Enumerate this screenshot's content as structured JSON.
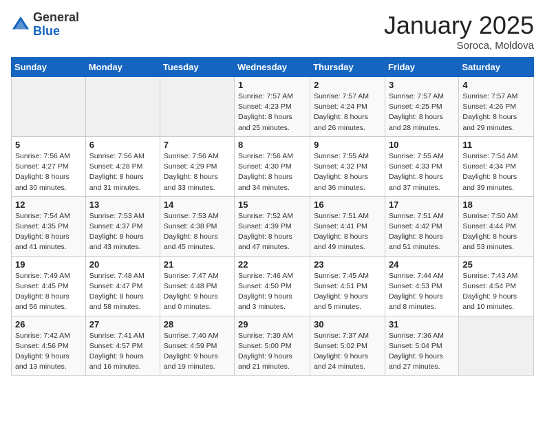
{
  "header": {
    "logo_general": "General",
    "logo_blue": "Blue",
    "month_title": "January 2025",
    "location": "Soroca, Moldova"
  },
  "weekdays": [
    "Sunday",
    "Monday",
    "Tuesday",
    "Wednesday",
    "Thursday",
    "Friday",
    "Saturday"
  ],
  "weeks": [
    [
      {
        "day": "",
        "info": ""
      },
      {
        "day": "",
        "info": ""
      },
      {
        "day": "",
        "info": ""
      },
      {
        "day": "1",
        "info": "Sunrise: 7:57 AM\nSunset: 4:23 PM\nDaylight: 8 hours\nand 25 minutes."
      },
      {
        "day": "2",
        "info": "Sunrise: 7:57 AM\nSunset: 4:24 PM\nDaylight: 8 hours\nand 26 minutes."
      },
      {
        "day": "3",
        "info": "Sunrise: 7:57 AM\nSunset: 4:25 PM\nDaylight: 8 hours\nand 28 minutes."
      },
      {
        "day": "4",
        "info": "Sunrise: 7:57 AM\nSunset: 4:26 PM\nDaylight: 8 hours\nand 29 minutes."
      }
    ],
    [
      {
        "day": "5",
        "info": "Sunrise: 7:56 AM\nSunset: 4:27 PM\nDaylight: 8 hours\nand 30 minutes."
      },
      {
        "day": "6",
        "info": "Sunrise: 7:56 AM\nSunset: 4:28 PM\nDaylight: 8 hours\nand 31 minutes."
      },
      {
        "day": "7",
        "info": "Sunrise: 7:56 AM\nSunset: 4:29 PM\nDaylight: 8 hours\nand 33 minutes."
      },
      {
        "day": "8",
        "info": "Sunrise: 7:56 AM\nSunset: 4:30 PM\nDaylight: 8 hours\nand 34 minutes."
      },
      {
        "day": "9",
        "info": "Sunrise: 7:55 AM\nSunset: 4:32 PM\nDaylight: 8 hours\nand 36 minutes."
      },
      {
        "day": "10",
        "info": "Sunrise: 7:55 AM\nSunset: 4:33 PM\nDaylight: 8 hours\nand 37 minutes."
      },
      {
        "day": "11",
        "info": "Sunrise: 7:54 AM\nSunset: 4:34 PM\nDaylight: 8 hours\nand 39 minutes."
      }
    ],
    [
      {
        "day": "12",
        "info": "Sunrise: 7:54 AM\nSunset: 4:35 PM\nDaylight: 8 hours\nand 41 minutes."
      },
      {
        "day": "13",
        "info": "Sunrise: 7:53 AM\nSunset: 4:37 PM\nDaylight: 8 hours\nand 43 minutes."
      },
      {
        "day": "14",
        "info": "Sunrise: 7:53 AM\nSunset: 4:38 PM\nDaylight: 8 hours\nand 45 minutes."
      },
      {
        "day": "15",
        "info": "Sunrise: 7:52 AM\nSunset: 4:39 PM\nDaylight: 8 hours\nand 47 minutes."
      },
      {
        "day": "16",
        "info": "Sunrise: 7:51 AM\nSunset: 4:41 PM\nDaylight: 8 hours\nand 49 minutes."
      },
      {
        "day": "17",
        "info": "Sunrise: 7:51 AM\nSunset: 4:42 PM\nDaylight: 8 hours\nand 51 minutes."
      },
      {
        "day": "18",
        "info": "Sunrise: 7:50 AM\nSunset: 4:44 PM\nDaylight: 8 hours\nand 53 minutes."
      }
    ],
    [
      {
        "day": "19",
        "info": "Sunrise: 7:49 AM\nSunset: 4:45 PM\nDaylight: 8 hours\nand 56 minutes."
      },
      {
        "day": "20",
        "info": "Sunrise: 7:48 AM\nSunset: 4:47 PM\nDaylight: 8 hours\nand 58 minutes."
      },
      {
        "day": "21",
        "info": "Sunrise: 7:47 AM\nSunset: 4:48 PM\nDaylight: 9 hours\nand 0 minutes."
      },
      {
        "day": "22",
        "info": "Sunrise: 7:46 AM\nSunset: 4:50 PM\nDaylight: 9 hours\nand 3 minutes."
      },
      {
        "day": "23",
        "info": "Sunrise: 7:45 AM\nSunset: 4:51 PM\nDaylight: 9 hours\nand 5 minutes."
      },
      {
        "day": "24",
        "info": "Sunrise: 7:44 AM\nSunset: 4:53 PM\nDaylight: 9 hours\nand 8 minutes."
      },
      {
        "day": "25",
        "info": "Sunrise: 7:43 AM\nSunset: 4:54 PM\nDaylight: 9 hours\nand 10 minutes."
      }
    ],
    [
      {
        "day": "26",
        "info": "Sunrise: 7:42 AM\nSunset: 4:56 PM\nDaylight: 9 hours\nand 13 minutes."
      },
      {
        "day": "27",
        "info": "Sunrise: 7:41 AM\nSunset: 4:57 PM\nDaylight: 9 hours\nand 16 minutes."
      },
      {
        "day": "28",
        "info": "Sunrise: 7:40 AM\nSunset: 4:59 PM\nDaylight: 9 hours\nand 19 minutes."
      },
      {
        "day": "29",
        "info": "Sunrise: 7:39 AM\nSunset: 5:00 PM\nDaylight: 9 hours\nand 21 minutes."
      },
      {
        "day": "30",
        "info": "Sunrise: 7:37 AM\nSunset: 5:02 PM\nDaylight: 9 hours\nand 24 minutes."
      },
      {
        "day": "31",
        "info": "Sunrise: 7:36 AM\nSunset: 5:04 PM\nDaylight: 9 hours\nand 27 minutes."
      },
      {
        "day": "",
        "info": ""
      }
    ]
  ]
}
